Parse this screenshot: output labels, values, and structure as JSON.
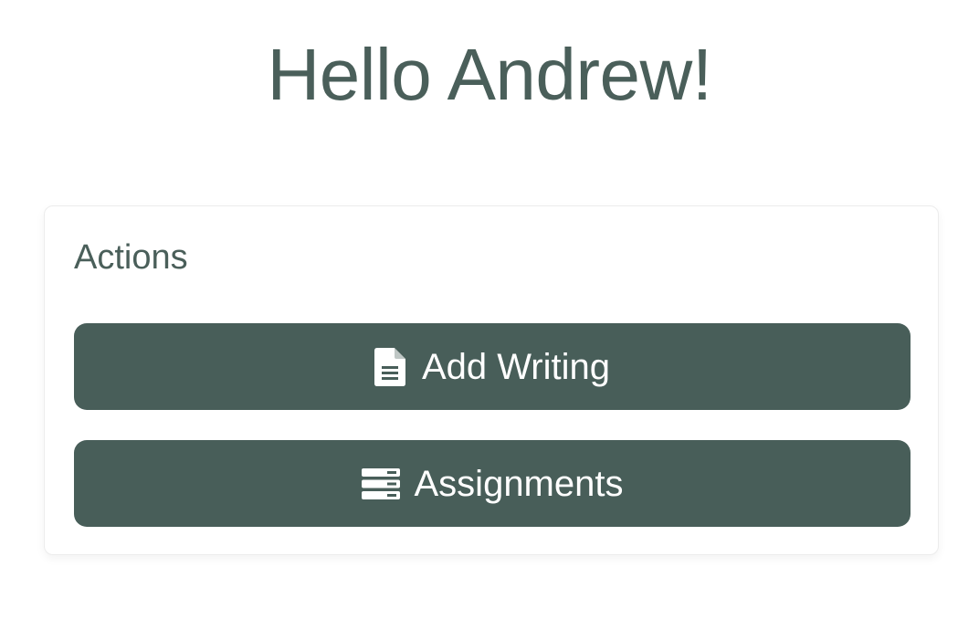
{
  "greeting": "Hello Andrew!",
  "actions_card": {
    "title": "Actions",
    "buttons": [
      {
        "label": "Add Writing",
        "icon": "file-document-icon"
      },
      {
        "label": "Assignments",
        "icon": "server-stack-icon"
      }
    ]
  },
  "colors": {
    "primary": "#485e59",
    "heading": "#4a5f5a",
    "background": "#ffffff"
  }
}
